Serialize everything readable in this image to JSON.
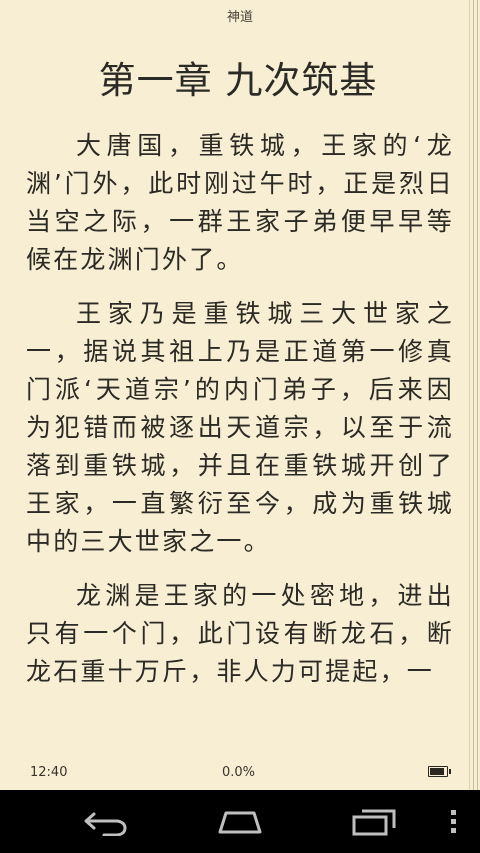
{
  "reader": {
    "book_title": "神道",
    "chapter_title": "第一章 九次筑基",
    "paragraphs": [
      "大唐国，重铁城，王家的‘龙渊’门外，此时刚过午时，正是烈日当空之际，一群王家子弟便早早等候在龙渊门外了。",
      "王家乃是重铁城三大世家之一，据说其祖上乃是正道第一修真门派‘天道宗’的内门弟子，后来因为犯错而被逐出天道宗，以至于流落到重铁城，并且在重铁城开创了王家，一直繁衍至今，成为重铁城中的三大世家之一。",
      "龙渊是王家的一处密地，进出只有一个门，此门设有断龙石，断龙石重十万斤，非人力可提起，一"
    ]
  },
  "status": {
    "time": "12:40",
    "progress": "0.0%",
    "battery_level": 0.9,
    "battery_icon": "battery-icon"
  },
  "nav": {
    "back_icon": "back-icon",
    "home_icon": "home-icon",
    "recents_icon": "recents-icon",
    "menu_icon": "overflow-menu-icon"
  },
  "colors": {
    "page_background": "#f8eed3",
    "text": "#2c2a24",
    "nav_bar": "#000000"
  }
}
